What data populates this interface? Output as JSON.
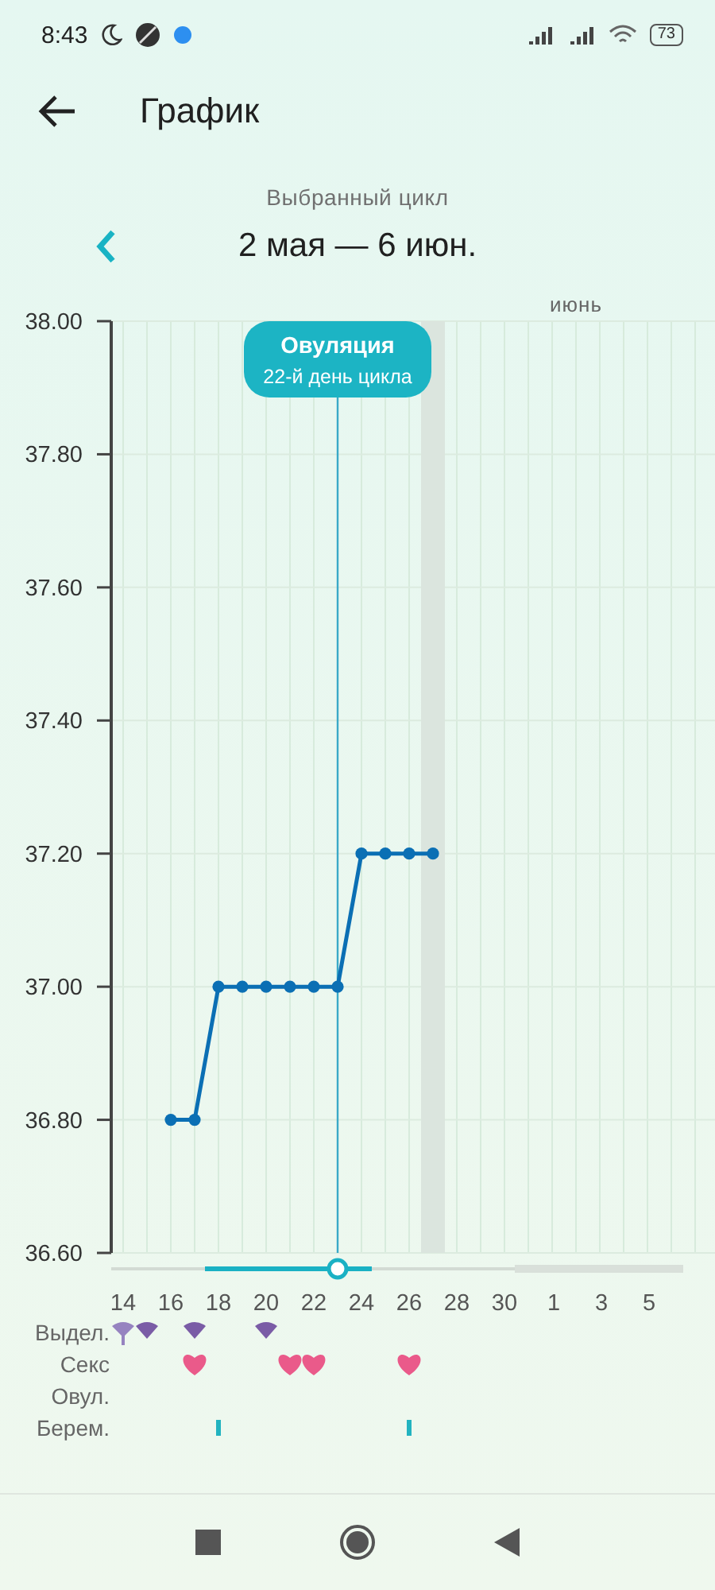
{
  "status_bar": {
    "time": "8:43",
    "battery": "73"
  },
  "header": {
    "title": "График"
  },
  "cycle": {
    "caption": "Выбранный цикл",
    "range": "2 мая — 6 июн."
  },
  "chart": {
    "month_label": "июнь",
    "june_tick_labels": [
      "1",
      "3",
      "5"
    ],
    "chart_data": {
      "type": "line",
      "x": [
        16,
        17,
        18,
        19,
        20,
        21,
        22,
        23,
        24,
        25,
        26,
        27
      ],
      "series": [
        {
          "color": "#0b6fb4",
          "marker": "o",
          "values": [
            36.8,
            36.8,
            37,
            37,
            37,
            37,
            37,
            37,
            37.2,
            37.2,
            37.2,
            37.2
          ]
        }
      ],
      "xlim": [
        13.5,
        37.5
      ],
      "ylim": [
        36.6,
        38
      ],
      "grid": true,
      "yticks": [
        {
          "value": 38,
          "label": "38.00"
        },
        {
          "value": 37.8,
          "label": "37.80"
        },
        {
          "value": 37.6,
          "label": "37.60"
        },
        {
          "value": 37.4,
          "label": "37.40"
        },
        {
          "value": 37.2,
          "label": "37.20"
        },
        {
          "value": 37,
          "label": "37.00"
        },
        {
          "value": 36.8,
          "label": "36.80"
        },
        {
          "value": 36.6,
          "label": "36.60"
        }
      ],
      "xticks": [
        14,
        16,
        18,
        20,
        22,
        24,
        26,
        28,
        30
      ],
      "ref_lines": [
        {
          "axis": "x",
          "value": 23,
          "color": "#3aa9c8"
        }
      ],
      "bands": [
        {
          "axis": "x",
          "from": 26.5,
          "to": 27.5,
          "color": "#dbe5de"
        }
      ],
      "annotations": [
        "Овуляция",
        "22-й день цикла"
      ]
    }
  },
  "event_rows": [
    {
      "label": "Выдел.",
      "marks": [
        {
          "kind": "drop-light"
        },
        {
          "kind": "drop"
        },
        {
          "kind": "none"
        },
        {
          "kind": "drop"
        },
        {
          "kind": "none"
        },
        {
          "kind": "none"
        },
        {
          "kind": "drop"
        }
      ]
    },
    {
      "label": "Секс",
      "marks": [
        {
          "kind": "none"
        },
        {
          "kind": "none"
        },
        {
          "kind": "none"
        },
        {
          "kind": "heart"
        },
        {
          "kind": "none"
        },
        {
          "kind": "none"
        },
        {
          "kind": "none"
        },
        {
          "kind": "heart"
        },
        {
          "kind": "heart"
        },
        {
          "kind": "none"
        },
        {
          "kind": "none"
        },
        {
          "kind": "none"
        },
        {
          "kind": "heart"
        }
      ]
    },
    {
      "label": "Овул."
    },
    {
      "label": "Берем.",
      "marks": [
        {
          "kind": "none"
        },
        {
          "kind": "none"
        },
        {
          "kind": "none"
        },
        {
          "kind": "none"
        },
        {
          "kind": "tick"
        },
        {
          "kind": "none"
        },
        {
          "kind": "none"
        },
        {
          "kind": "none"
        },
        {
          "kind": "none"
        },
        {
          "kind": "none"
        },
        {
          "kind": "none"
        },
        {
          "kind": "none"
        },
        {
          "kind": "tick"
        }
      ]
    }
  ]
}
